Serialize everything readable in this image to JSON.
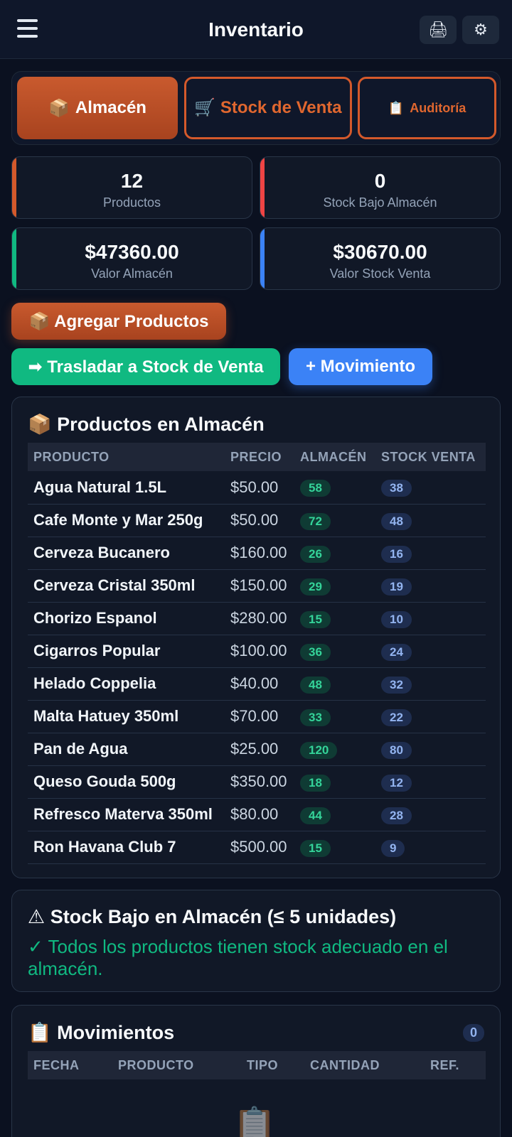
{
  "header": {
    "title": "Inventario",
    "menu_icon": "hamburger-icon",
    "print_icon": "🖨",
    "settings_icon": "⚙"
  },
  "tabs": [
    {
      "icon": "📦",
      "label": "Almacén",
      "active": true
    },
    {
      "icon": "🛒",
      "label": "Stock de Venta",
      "active": false
    },
    {
      "icon": "📋",
      "label": "Auditoría",
      "active": false
    }
  ],
  "stats": [
    {
      "value": "12",
      "label": "Productos"
    },
    {
      "value": "0",
      "label": "Stock Bajo Almacén"
    },
    {
      "value": "$47360.00",
      "label": "Valor Almacén"
    },
    {
      "value": "$30670.00",
      "label": "Valor Stock Venta"
    }
  ],
  "actions": {
    "add_products": "📦 Agregar Productos",
    "transfer": "➡ Trasladar a Stock de Venta",
    "movement": "+ Movimiento"
  },
  "inventory": {
    "title": "📦 Productos en Almacén",
    "columns": [
      "PRODUCTO",
      "PRECIO",
      "ALMACÉN",
      "STOCK VENTA"
    ],
    "rows": [
      {
        "name": "Agua Natural 1.5L",
        "price": "$50.00",
        "warehouse": "58",
        "sale": "38"
      },
      {
        "name": "Cafe Monte y Mar 250g",
        "price": "$50.00",
        "warehouse": "72",
        "sale": "48"
      },
      {
        "name": "Cerveza Bucanero",
        "price": "$160.00",
        "warehouse": "26",
        "sale": "16"
      },
      {
        "name": "Cerveza Cristal 350ml",
        "price": "$150.00",
        "warehouse": "29",
        "sale": "19"
      },
      {
        "name": "Chorizo Espanol",
        "price": "$280.00",
        "warehouse": "15",
        "sale": "10"
      },
      {
        "name": "Cigarros Popular",
        "price": "$100.00",
        "warehouse": "36",
        "sale": "24"
      },
      {
        "name": "Helado Coppelia",
        "price": "$40.00",
        "warehouse": "48",
        "sale": "32"
      },
      {
        "name": "Malta Hatuey 350ml",
        "price": "$70.00",
        "warehouse": "33",
        "sale": "22"
      },
      {
        "name": "Pan de Agua",
        "price": "$25.00",
        "warehouse": "120",
        "sale": "80"
      },
      {
        "name": "Queso Gouda 500g",
        "price": "$350.00",
        "warehouse": "18",
        "sale": "12"
      },
      {
        "name": "Refresco Materva 350ml",
        "price": "$80.00",
        "warehouse": "44",
        "sale": "28"
      },
      {
        "name": "Ron Havana Club 7",
        "price": "$500.00",
        "warehouse": "15",
        "sale": "9"
      }
    ]
  },
  "low_stock": {
    "title": "⚠ Stock Bajo en Almacén (≤ 5 unidades)",
    "message": "✓ Todos los productos tienen stock adecuado en el almacén."
  },
  "movements": {
    "title": "📋 Movimientos",
    "count": "0",
    "columns": [
      "FECHA",
      "PRODUCTO",
      "TIPO",
      "CANTIDAD",
      "REF."
    ],
    "empty_icon": "📋"
  }
}
